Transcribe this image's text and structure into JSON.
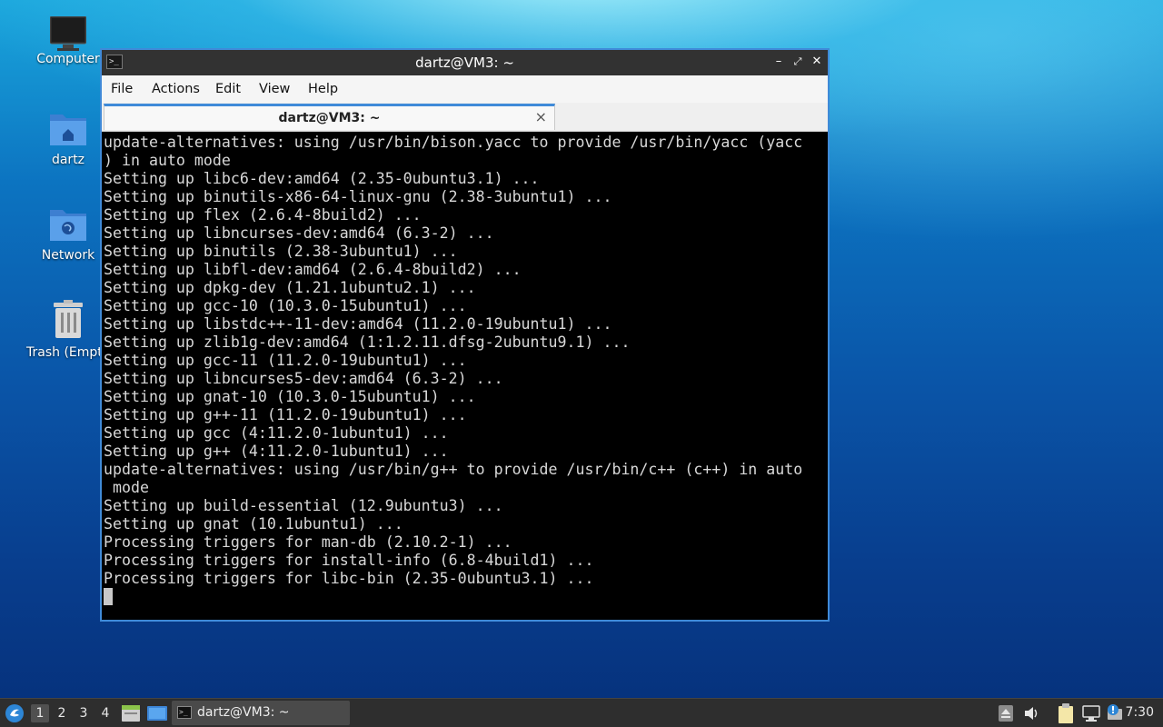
{
  "desktop": {
    "icons": [
      {
        "label": "Computer"
      },
      {
        "label": "dartz"
      },
      {
        "label": "Network"
      },
      {
        "label": "Trash (Empt"
      }
    ]
  },
  "window": {
    "title": "dartz@VM3: ~",
    "menu": [
      "File",
      "Actions",
      "Edit",
      "View",
      "Help"
    ],
    "tab_label": "dartz@VM3: ~",
    "tab_close": "×",
    "terminal_lines": [
      "update-alternatives: using /usr/bin/bison.yacc to provide /usr/bin/yacc (yacc",
      ") in auto mode",
      "Setting up libc6-dev:amd64 (2.35-0ubuntu3.1) ...",
      "Setting up binutils-x86-64-linux-gnu (2.38-3ubuntu1) ...",
      "Setting up flex (2.6.4-8build2) ...",
      "Setting up libncurses-dev:amd64 (6.3-2) ...",
      "Setting up binutils (2.38-3ubuntu1) ...",
      "Setting up libfl-dev:amd64 (2.6.4-8build2) ...",
      "Setting up dpkg-dev (1.21.1ubuntu2.1) ...",
      "Setting up gcc-10 (10.3.0-15ubuntu1) ...",
      "Setting up libstdc++-11-dev:amd64 (11.2.0-19ubuntu1) ...",
      "Setting up zlib1g-dev:amd64 (1:1.2.11.dfsg-2ubuntu9.1) ...",
      "Setting up gcc-11 (11.2.0-19ubuntu1) ...",
      "Setting up libncurses5-dev:amd64 (6.3-2) ...",
      "Setting up gnat-10 (10.3.0-15ubuntu1) ...",
      "Setting up g++-11 (11.2.0-19ubuntu1) ...",
      "Setting up gcc (4:11.2.0-1ubuntu1) ...",
      "Setting up g++ (4:11.2.0-1ubuntu1) ...",
      "update-alternatives: using /usr/bin/g++ to provide /usr/bin/c++ (c++) in auto",
      " mode",
      "Setting up build-essential (12.9ubuntu3) ...",
      "Setting up gnat (10.1ubuntu1) ...",
      "Processing triggers for man-db (2.10.2-1) ...",
      "Processing triggers for install-info (6.8-4build1) ...",
      "Processing triggers for libc-bin (2.35-0ubuntu3.1) ..."
    ]
  },
  "taskbar": {
    "workspaces": [
      "1",
      "2",
      "3",
      "4"
    ],
    "active_workspace": "1",
    "task_label": "dartz@VM3: ~",
    "clock": "7:30"
  },
  "colors": {
    "accent": "#3f8ad8",
    "terminal_bg": "#000000",
    "terminal_fg": "#d8d8d8",
    "taskbar_bg": "#2e2e2e"
  }
}
